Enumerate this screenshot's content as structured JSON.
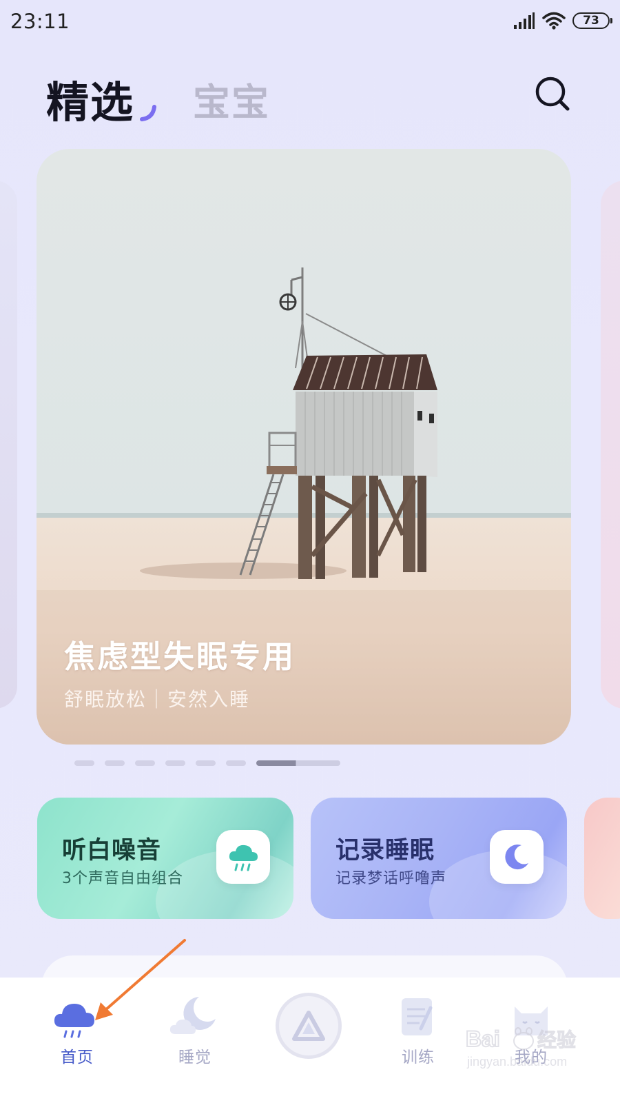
{
  "status_bar": {
    "time": "23:11",
    "battery": "73"
  },
  "header": {
    "tab_featured": "精选",
    "tab_baby": "宝宝",
    "search_icon": "search-icon"
  },
  "banner": {
    "title": "焦虑型失眠专用",
    "subtitle": "舒眠放松｜安然入睡",
    "page_count": 7,
    "active_page": 7
  },
  "features": [
    {
      "title": "听白噪音",
      "desc": "3个声音自由组合",
      "icon": "rain-cloud-icon",
      "accent": "#3ec3b0"
    },
    {
      "title": "记录睡眠",
      "desc": "记录梦话呼噜声",
      "icon": "moon-icon",
      "accent": "#7c86f0"
    }
  ],
  "bottom_nav": {
    "items": [
      {
        "label": "首页",
        "icon": "rain-cloud-icon",
        "active": true
      },
      {
        "label": "睡觉",
        "icon": "moon-cloud-icon",
        "active": false
      },
      {
        "label": "",
        "icon": "triangle-play-icon",
        "active": false
      },
      {
        "label": "训练",
        "icon": "notebook-icon",
        "active": false
      },
      {
        "label": "我的",
        "icon": "cat-avatar-icon",
        "active": false
      }
    ]
  },
  "watermark": {
    "brand": "Baidu经验",
    "url": "jingyan.baidu.com"
  },
  "colors": {
    "active_nav": "#4458c8",
    "inactive_nav": "#a5a7c5",
    "annotation_arrow": "#f07a33"
  }
}
